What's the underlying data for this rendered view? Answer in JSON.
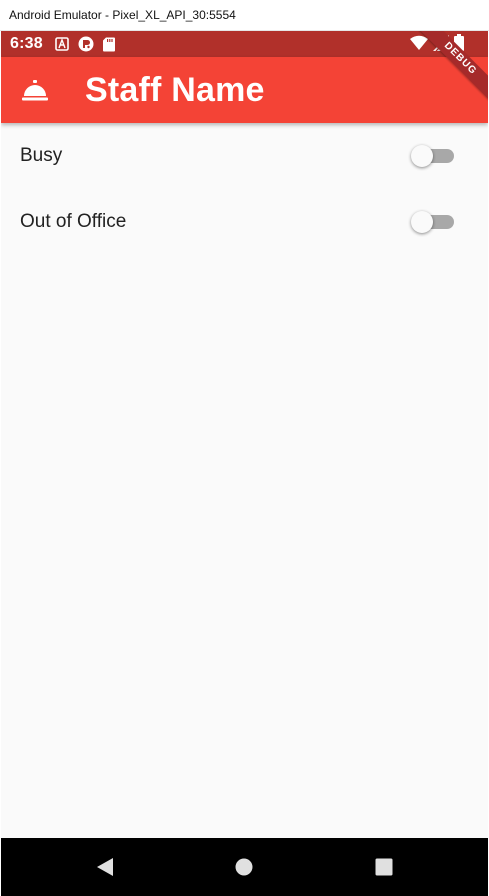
{
  "window": {
    "title": "Android Emulator - Pixel_XL_API_30:5554"
  },
  "status_bar": {
    "time": "6:38",
    "left_icons": [
      "font-app-icon",
      "notification-app-icon",
      "sd-card-icon"
    ],
    "right_icons": [
      "wifi-icon",
      "signal-icon",
      "battery-icon"
    ],
    "color": "#b1302a"
  },
  "app_bar": {
    "title": "Staff Name",
    "icon": "room-service-bell-icon",
    "color": "#f44336"
  },
  "debug_banner": {
    "text": "DEBUG"
  },
  "settings": [
    {
      "label": "Busy",
      "value": false
    },
    {
      "label": "Out of Office",
      "value": false
    }
  ],
  "nav_bar": {
    "buttons": [
      "back-icon",
      "home-icon",
      "recents-icon"
    ]
  }
}
